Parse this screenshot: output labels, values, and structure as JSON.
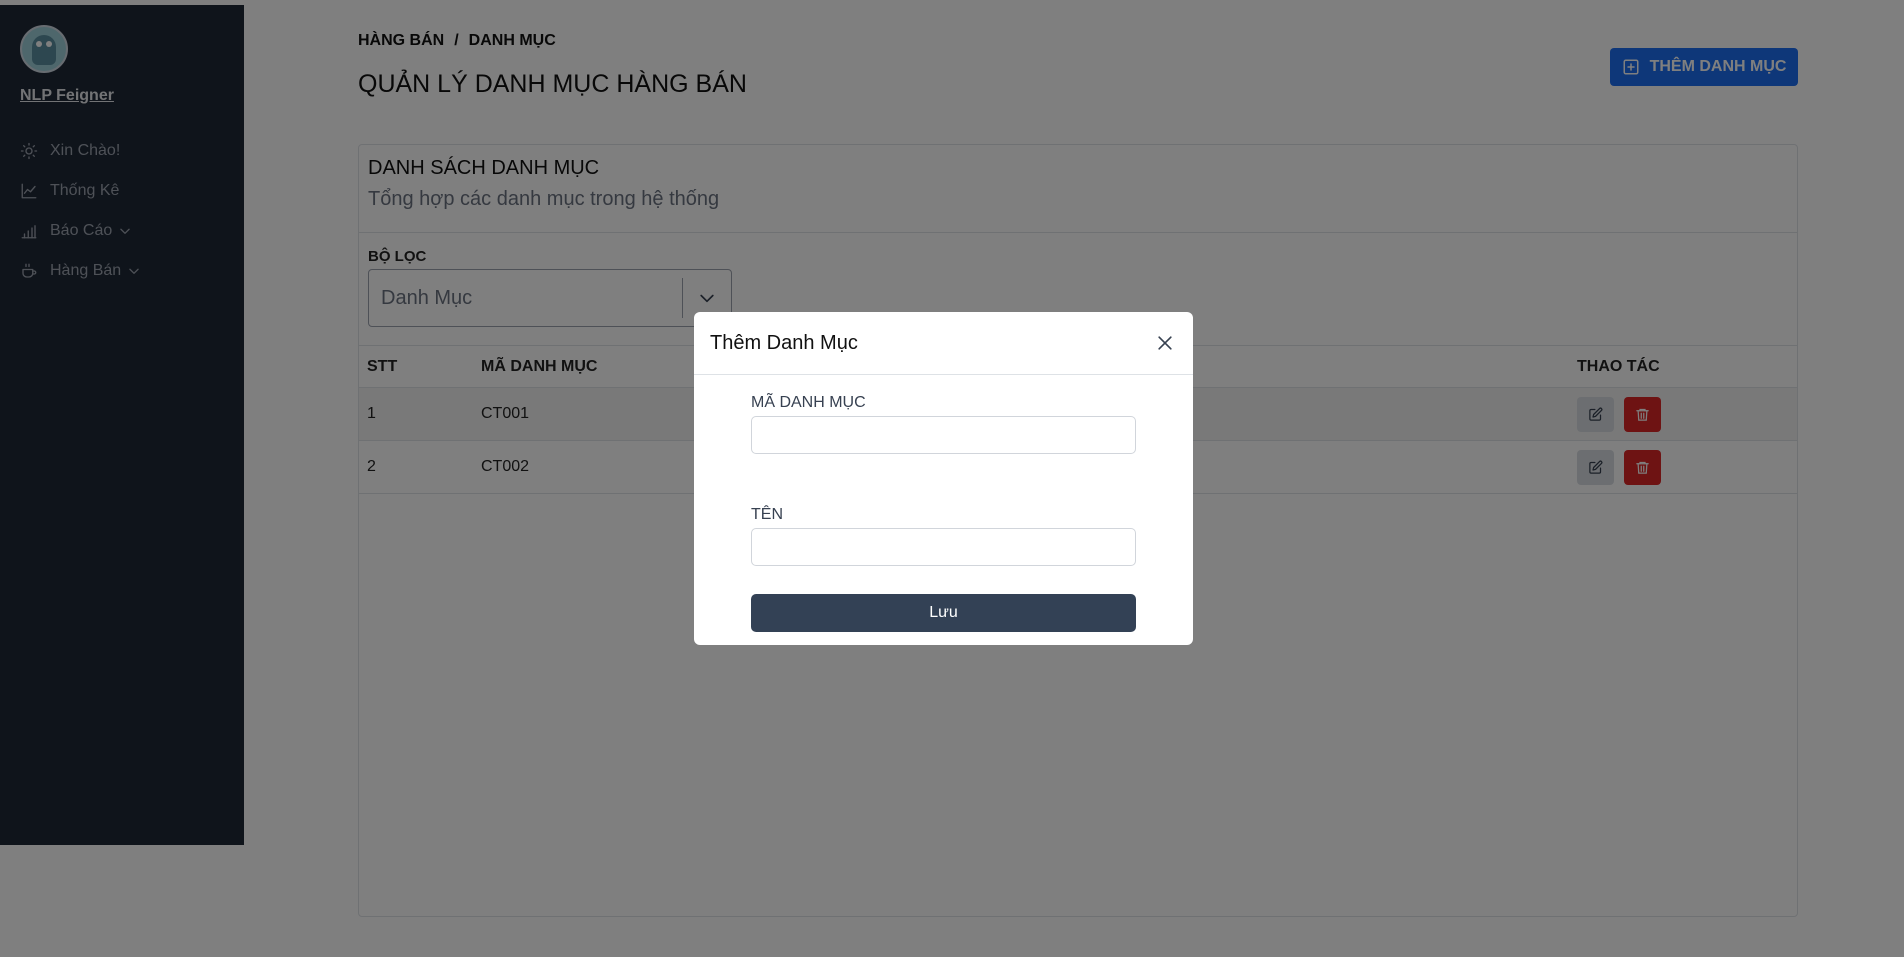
{
  "sidebar": {
    "user_name": "NLP Feigner",
    "items": [
      {
        "label": "Xin Chào!",
        "icon": "sun-icon"
      },
      {
        "label": "Thống Kê",
        "icon": "chart-line-icon"
      },
      {
        "label": "Báo Cáo",
        "icon": "bar-chart-icon"
      },
      {
        "label": "Hàng Bán",
        "icon": "cup-icon"
      }
    ]
  },
  "breadcrumb": {
    "first": "HÀNG BÁN",
    "separator": "/",
    "second": "DANH MỤC"
  },
  "page_title": "QUẢN LÝ DANH MỤC HÀNG BÁN",
  "add_button_label": "THÊM DANH MỤC",
  "card": {
    "title": "DANH SÁCH DANH MỤC",
    "subtitle": "Tổng hợp các danh mục trong hệ thống",
    "filter_label": "BỘ LỌC",
    "filter_placeholder": "Danh Mục"
  },
  "table": {
    "headers": {
      "stt": "STT",
      "ma": "MÃ DANH MỤC",
      "actions": "THAO TÁC"
    },
    "rows": [
      {
        "stt": "1",
        "ma": "CT001"
      },
      {
        "stt": "2",
        "ma": "CT002"
      }
    ]
  },
  "modal": {
    "title": "Thêm Danh Mục",
    "field_code_label": "MÃ DANH MỤC",
    "field_code_value": "",
    "field_name_label": "TÊN",
    "field_name_value": "",
    "save_label": "Lưu"
  },
  "colors": {
    "sidebar_bg": "#1f2937",
    "primary": "#1d6ff2",
    "danger": "#dc2626",
    "save_button": "#334155"
  }
}
